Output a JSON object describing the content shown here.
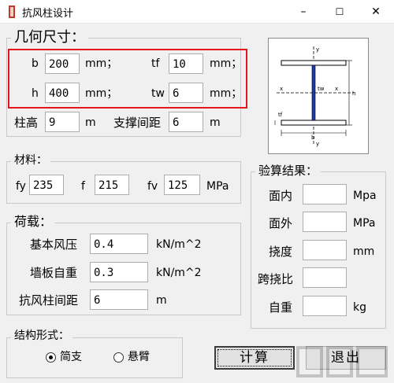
{
  "window": {
    "title": "抗风柱设计",
    "minimize": "–",
    "maximize": "☐",
    "close": "✕"
  },
  "geometry": {
    "title": "几何尺寸：",
    "b": {
      "label": "b",
      "value": "200",
      "unit": "mm；"
    },
    "tf": {
      "label": "tf",
      "value": "10",
      "unit": "mm；"
    },
    "h": {
      "label": "h",
      "value": "400",
      "unit": "mm；"
    },
    "tw": {
      "label": "tw",
      "value": "6",
      "unit": "mm；"
    },
    "column_height": {
      "label": "柱高",
      "value": "9",
      "unit": "m"
    },
    "brace_spacing": {
      "label": "支撑间距",
      "value": "6",
      "unit": "m"
    }
  },
  "diagram_labels": {
    "y_top": "y",
    "y_bottom": "y",
    "x_left": "x",
    "x_right": "x",
    "tw": "tw",
    "h": "h",
    "tf": "tf",
    "b": "b"
  },
  "material": {
    "title": "材料：",
    "fy": {
      "label": "fy",
      "value": "235"
    },
    "f": {
      "label": "f",
      "value": "215"
    },
    "fv": {
      "label": "fv",
      "value": "125",
      "unit": "MPa"
    }
  },
  "load": {
    "title": "荷载：",
    "wind_pressure": {
      "label": "基本风压",
      "value": "0.4",
      "unit": "kN/m^2"
    },
    "wall_weight": {
      "label": "墙板自重",
      "value": "0.3",
      "unit": "kN/m^2"
    },
    "column_spacing": {
      "label": "抗风柱间距",
      "value": "6",
      "unit": "m"
    }
  },
  "results": {
    "title": "验算结果：",
    "in_plane": {
      "label": "面内",
      "value": "",
      "unit": "Mpa"
    },
    "out_plane": {
      "label": "面外",
      "value": "",
      "unit": "MPa"
    },
    "deflection": {
      "label": "挠度",
      "value": "",
      "unit": "mm"
    },
    "deflection_ratio": {
      "label": "跨挠比",
      "value": ""
    },
    "self_weight": {
      "label": "自重",
      "value": "",
      "unit": "kg"
    }
  },
  "structure": {
    "title": "结构形式：",
    "options": [
      {
        "label": "简支",
        "selected": true
      },
      {
        "label": "悬臂",
        "selected": false
      }
    ]
  },
  "buttons": {
    "calculate": "计算",
    "exit": "退出"
  }
}
